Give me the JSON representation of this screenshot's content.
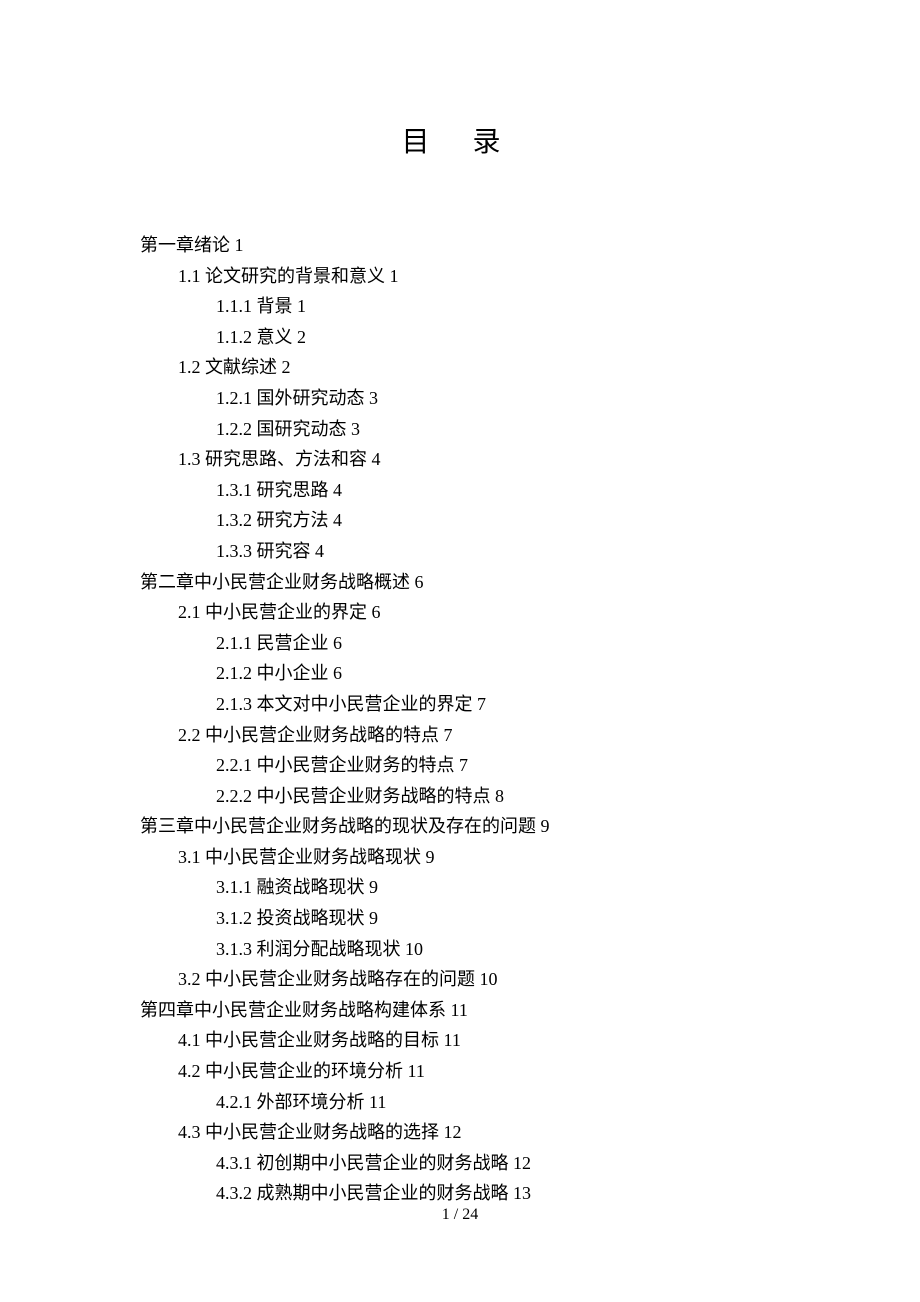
{
  "title": "目  录",
  "toc": [
    {
      "level": 0,
      "text": "第一章绪论 1"
    },
    {
      "level": 1,
      "text": "1.1   论文研究的背景和意义 1"
    },
    {
      "level": 2,
      "text": "1.1.1 背景 1"
    },
    {
      "level": 2,
      "text": "1.1.2 意义 2"
    },
    {
      "level": 1,
      "text": "1.2 文献综述 2"
    },
    {
      "level": 2,
      "text": "1.2.1 国外研究动态 3"
    },
    {
      "level": 2,
      "text": "1.2.2 国研究动态 3"
    },
    {
      "level": 1,
      "text": "1.3 研究思路、方法和容 4"
    },
    {
      "level": 2,
      "text": "1.3.1 研究思路 4"
    },
    {
      "level": 2,
      "text": "1.3.2 研究方法 4"
    },
    {
      "level": 2,
      "text": "1.3.3 研究容 4"
    },
    {
      "level": 0,
      "text": "第二章中小民营企业财务战略概述 6"
    },
    {
      "level": 1,
      "text": "2.1 中小民营企业的界定 6"
    },
    {
      "level": 2,
      "text": "2.1.1 民营企业 6"
    },
    {
      "level": 2,
      "text": "2.1.2 中小企业 6"
    },
    {
      "level": 2,
      "text": "2.1.3 本文对中小民营企业的界定 7"
    },
    {
      "level": 1,
      "text": "2.2 中小民营企业财务战略的特点 7"
    },
    {
      "level": 2,
      "text": "2.2.1 中小民营企业财务的特点 7"
    },
    {
      "level": 2,
      "text": "2.2.2 中小民营企业财务战略的特点 8"
    },
    {
      "level": 0,
      "text": "第三章中小民营企业财务战略的现状及存在的问题 9"
    },
    {
      "level": 1,
      "text": "3.1 中小民营企业财务战略现状 9"
    },
    {
      "level": 2,
      "text": "3.1.1 融资战略现状 9"
    },
    {
      "level": 2,
      "text": "3.1.2 投资战略现状 9"
    },
    {
      "level": 2,
      "text": "3.1.3 利润分配战略现状 10"
    },
    {
      "level": 1,
      "text": "3.2 中小民营企业财务战略存在的问题 10"
    },
    {
      "level": 0,
      "text": "第四章中小民营企业财务战略构建体系 11"
    },
    {
      "level": 1,
      "text": "4.1 中小民营企业财务战略的目标 11"
    },
    {
      "level": 1,
      "text": "4.2 中小民营企业的环境分析 11"
    },
    {
      "level": 2,
      "text": "4.2.1 外部环境分析 11"
    },
    {
      "level": 1,
      "text": "4.3 中小民营企业财务战略的选择 12"
    },
    {
      "level": 2,
      "text": "4.3.1 初创期中小民营企业的财务战略 12"
    },
    {
      "level": 2,
      "text": "4.3.2 成熟期中小民营企业的财务战略 13"
    }
  ],
  "footer": "1 / 24"
}
